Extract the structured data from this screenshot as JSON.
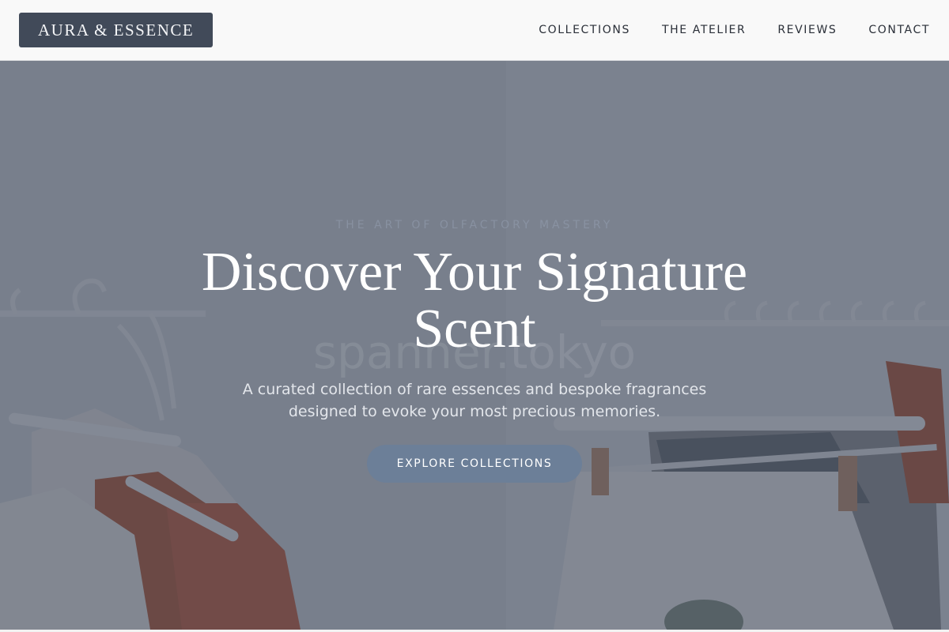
{
  "brand": {
    "name": "AURA & ESSENCE"
  },
  "nav": {
    "items": [
      {
        "label": "COLLECTIONS"
      },
      {
        "label": "THE ATELIER"
      },
      {
        "label": "REVIEWS"
      },
      {
        "label": "CONTACT"
      }
    ]
  },
  "hero": {
    "eyebrow": "THE ART OF OLFACTORY MASTERY",
    "headline": "Discover Your Signature Scent",
    "subtitle": "A curated collection of rare essences and bespoke fragrances designed to evoke your most precious memories.",
    "cta_label": "EXPLORE COLLECTIONS",
    "watermark": "spanner.tokyo"
  },
  "colors": {
    "brand_badge": "#414a59",
    "overlay": "#3e475a",
    "cta": "#6c7f98",
    "accent_garment": "#b44a22"
  }
}
